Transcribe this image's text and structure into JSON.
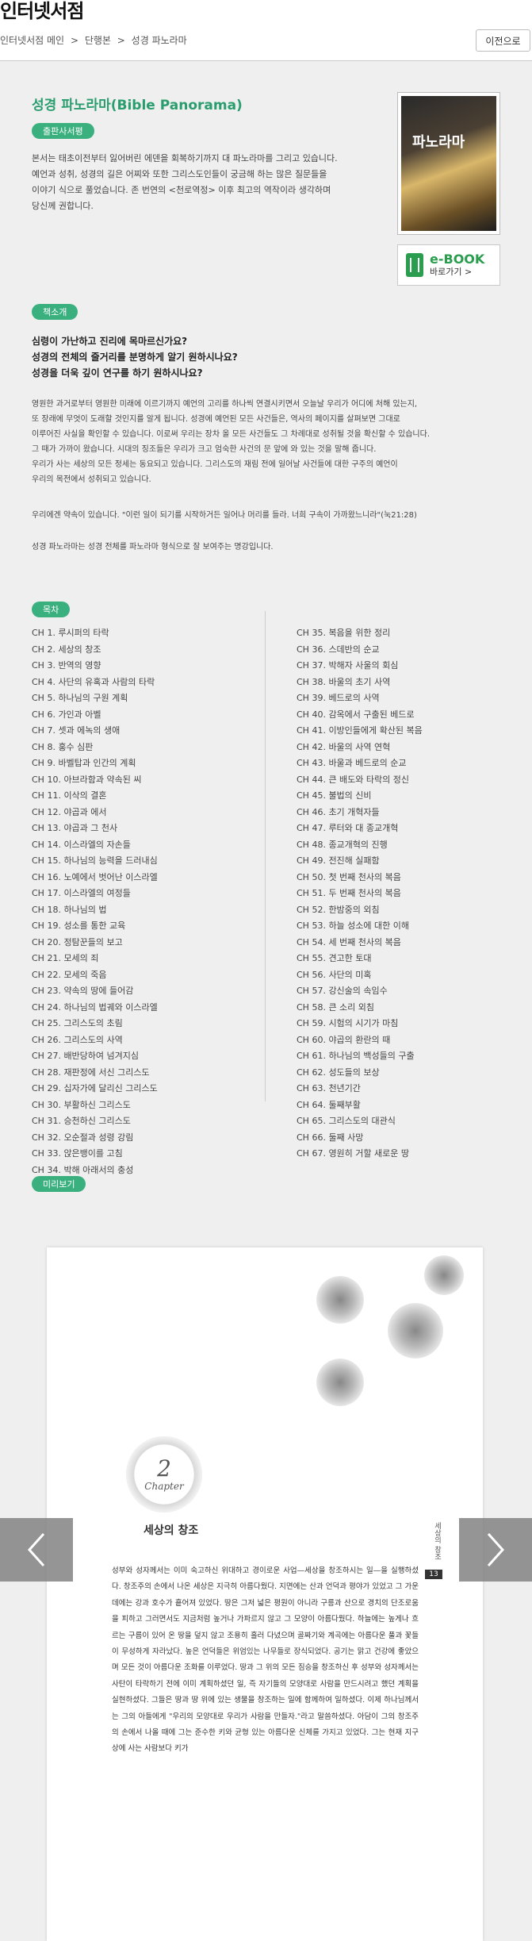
{
  "header": {
    "site_title": "인터넷서점",
    "breadcrumb": [
      "인터넷서점 메인",
      ">",
      "단행본",
      ">",
      "성경 파노라마"
    ],
    "prev_button": "이전으로"
  },
  "book": {
    "title": "성경 파노라마(Bible Panorama)",
    "cover_title": "파노라마",
    "ebook_label": "e-BOOK",
    "ebook_sub": "바로가기 >"
  },
  "publisher_review": {
    "badge": "출판사서평",
    "lines": [
      "본서는 태초이전부터 잃어버린 에덴을 회복하기까지 대 파노라마를 그리고 있습니다.",
      "예언과 성취, 성경의 길은 어찌와 또한 그리스도인들이 궁금해 하는 많은 질문들을",
      "이야기 식으로 풀었습니다. 존 번연의 <천로역정> 이후 최고의 역작이라 생각하며",
      "당신께 권합니다."
    ]
  },
  "intro": {
    "badge": "책소개",
    "questions": [
      "심령이 가난하고 진리에 목마르신가요?",
      "성경의 전체의 줄거리를 분명하게 알기 원하시나요?",
      "성경을 더욱 깊이 연구를 하기 원하시나요?"
    ],
    "para1": [
      "영원한 과거로부터 영원한 미래에 이르기까지 예언의 고리를 하나씩 연결시키면서 오늘날 우리가 어디에 처해 있는지,",
      "또 장래에 무엇이 도래할 것인지를 알게 됩니다. 성경에 예언된 모든 사건들은, 역사의 페이지를 살펴보면 그대로",
      "이루어진 사실을 확인할 수 있습니다. 이로써 우리는 장차 올 모든 사건들도 그 차례대로 성취될 것을 확신할 수 있습니다.",
      "그 때가 가까이 왔습니다. 시대의 징조들은 우리가 크고 엄숙한 사건의 문 앞에 와 있는 것을 말해 줍니다.",
      "우리가 사는 세상의 모든 정세는 동요되고 있습니다. 그리스도의 재림 전에 일어날 사건들에 대한 구주의 예언이",
      "우리의 목전에서 성취되고 있습니다."
    ],
    "para2": "우리에겐 약속이 있습니다. \"이런 일이 되기를 시작하거든 일어나 머리를 들라. 너희 구속이 가까왔느니라\"(눅21:28)",
    "para3": "성경 파노라마는 성경 전체를 파노라마 형식으로 잘 보여주는 명강입니다."
  },
  "toc": {
    "badge": "목차",
    "left": [
      "CH 1. 루시퍼의 타락",
      "CH 2. 세상의 창조",
      "CH 3. 반역의 영향",
      "CH 4. 사단의 유혹과 사람의 타락",
      "CH 5. 하나님의 구원 계획",
      "CH 6. 가인과 아벨",
      "CH 7. 셋과 에녹의 생애",
      "CH 8. 홍수 심판",
      "CH 9. 바벨탑과 인간의 계획",
      "CH 10. 아브라함과 약속된 씨",
      "CH 11. 이삭의 결혼",
      "CH 12. 야곱과 에서",
      "CH 13. 야곱과 그 천사",
      "CH 14. 이스라엘의 자손들",
      "CH 15. 하나님의 능력을 드러내심",
      "CH 16. 노예에서 벗어난 이스라엘",
      "CH 17. 이스라엘의 여정들",
      "CH 18. 하나님의 법",
      "CH 19. 성소를 통한 교육",
      "CH 20. 정탐꾼들의 보고",
      "CH 21. 모세의 죄",
      "CH 22. 모세의 죽음",
      "CH 23. 약속의 땅에 들어감",
      "CH 24. 하나님의 법궤와 이스라엘",
      "CH 25. 그리스도의 초림",
      "CH 26. 그리스도의 사역",
      "CH 27. 배반당하여 넘겨지심",
      "CH 28. 재판정에 서신 그리스도",
      "CH 29. 십자가에 달리신 그리스도",
      "CH 30. 부활하신 그리스도",
      "CH 31. 승천하신 그리스도",
      "CH 32. 오순절과 성령 강림",
      "CH 33. 앉은뱅이를 고침",
      "CH 34. 박해 아래서의 충성"
    ],
    "right": [
      "CH 35. 복음을 위한 정리",
      "CH 36. 스데반의 순교",
      "CH 37. 박해자 사울의 회심",
      "CH 38. 바울의 초기 사역",
      "CH 39. 베드로의 사역",
      "CH 40. 감옥에서 구출된 베드로",
      "CH 41. 이방인들에게 확산된 복음",
      "CH 42. 바울의 사역 연혁",
      "CH 43. 바울과 베드로의 순교",
      "CH 44. 큰 배도와 타락의 정신",
      "CH 45. 불법의 신비",
      "CH 46. 초기 개혁자들",
      "CH 47. 루터와 대 종교개혁",
      "CH 48. 종교개혁의 진행",
      "CH 49. 전진해 실패함",
      "CH 50. 첫 번째 천사의 복음",
      "CH 51. 두 번째 천사의 복음",
      "CH 52. 한밤중의 외침",
      "CH 53. 하늘 성소에 대한 이해",
      "CH 54. 세 번째 천사의 복음",
      "CH 55. 견고한 토대",
      "CH 56. 사단의 미혹",
      "CH 57. 강신술의 속임수",
      "CH 58. 큰 소리 외침",
      "CH 59. 시험의 시기가 마침",
      "CH 60. 야곱의 환란의 때",
      "CH 61. 하나님의 백성들의 구출",
      "CH 62. 성도들의 보상",
      "CH 63. 천년기간",
      "CH 64. 둘째부활",
      "CH 65. 그리스도의 대관식",
      "CH 66. 둘째 사망",
      "CH 67. 영원히 거할 새로운 땅"
    ]
  },
  "preview": {
    "badge": "미리보기",
    "chapter_num": "2",
    "chapter_word": "Chapter",
    "chapter_title": "세상의 창조",
    "side_label": "세상의 창조",
    "page_number": "13",
    "body": "성부와 성자께서는 이미 숙고하신 위대하고 경이로운 사업—세상을 창조하시는 일—을 실행하셨다. 창조주의 손에서 나온 세상은 지극히 아름다웠다. 지면에는 산과 언덕과 평야가 있었고 그 가운데에는 강과 호수가 흩어져 있었다. 땅은 그저 넓은 평원이 아니라 구릉과 산으로 경치의 단조로움을 피하고 그러면서도 지금처럼 높거나 가파르지 않고 그 모양이 아름다웠다. 하늘에는 높게나 흐르는 구름이 있어 온 땅을 덮지 않고 조용히 흘러 다녔으며 골짜기와 계곡에는 아름다운 풀과 꽃들이 무성하게 자라났다. 높은 언덕들은 위엄있는 나무들로 장식되었다. 공기는 맑고 건강에 좋았으며 모든 것이 아름다운 조화를 이루었다. 땅과 그 위의 모든 짐승을 창조하신 후 성부와 성자께서는 사탄이 타락하기 전에 이미 계획하셨던 일, 즉 자기들의 모양대로 사람을 만드시려고 했던 계획을 실현하셨다. 그들은 땅과 땅 위에 있는 생물을 창조하는 일에 함께하여 일하셨다. 이제 하나님께서는 그의 아들에게 \"우리의 모양대로 우리가 사람을 만들자.\"라고 말씀하셨다. 아담이 그의 창조주의 손에서 나올 때에 그는 준수한 키와 균형 있는 아름다운 신체를 가지고 있었다. 그는 현재 지구상에 사는 사람보다 키가"
  }
}
